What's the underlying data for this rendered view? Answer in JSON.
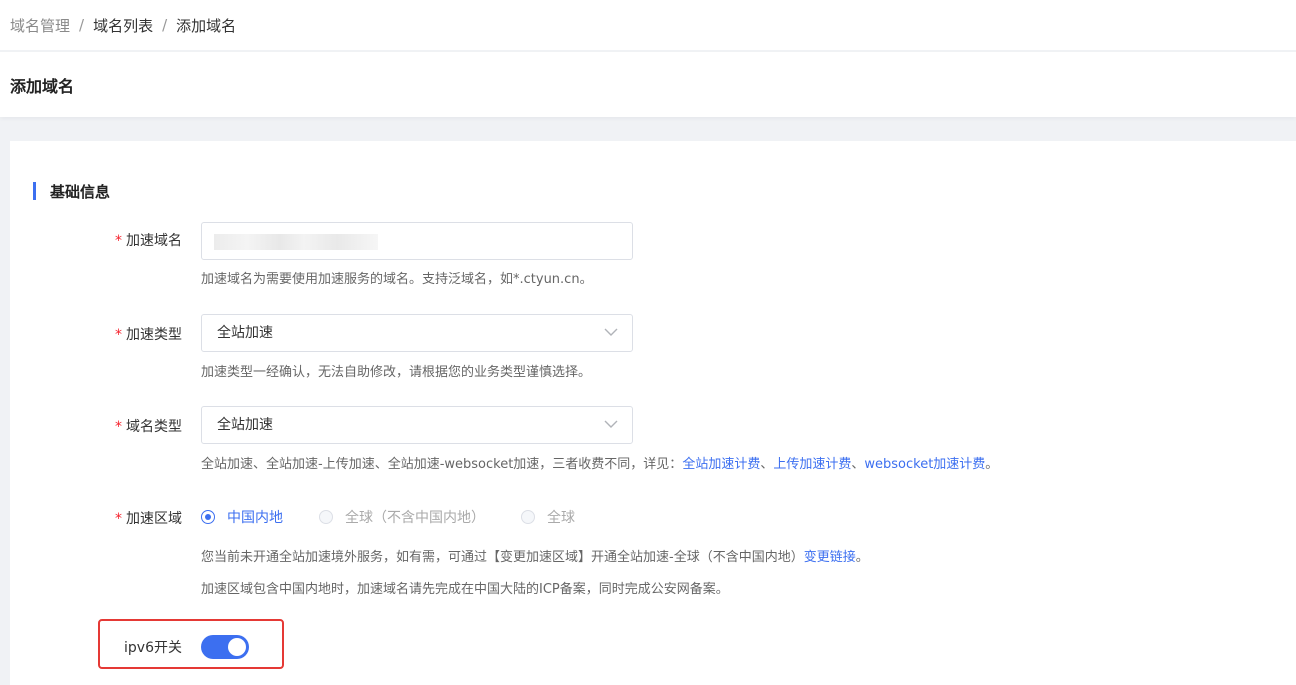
{
  "breadcrumb": {
    "items": [
      "域名管理",
      "域名列表",
      "添加域名"
    ],
    "separator": "/"
  },
  "page": {
    "title": "添加域名"
  },
  "section": {
    "title": "基础信息"
  },
  "form": {
    "required_mark": "*",
    "domain": {
      "label": "加速域名",
      "help": "加速域名为需要使用加速服务的域名。支持泛域名，如*.ctyun.cn。"
    },
    "accel_type": {
      "label": "加速类型",
      "value": "全站加速",
      "help": "加速类型一经确认，无法自助修改，请根据您的业务类型谨慎选择。"
    },
    "domain_type": {
      "label": "域名类型",
      "value": "全站加速",
      "help_prefix": "全站加速、全站加速-上传加速、全站加速-websocket加速，三者收费不同，详见：",
      "link1": "全站加速计费",
      "sep1": "、",
      "link2": "上传加速计费",
      "sep2": "、",
      "link3": "websocket加速计费",
      "help_suffix": "。"
    },
    "region": {
      "label": "加速区域",
      "options": [
        "中国内地",
        "全球（不含中国内地）",
        "全球"
      ],
      "help1_prefix": "您当前未开通全站加速境外服务，如有需，可通过【变更加速区域】开通全站加速-全球（不含中国内地）",
      "help1_link": "变更链接",
      "help1_suffix": "。",
      "help2": "加速区域包含中国内地时，加速域名请先完成在中国大陆的ICP备案，同时完成公安网备案。"
    },
    "ipv6": {
      "label": "ipv6开关",
      "enabled": true
    }
  },
  "colors": {
    "accent": "#3c6ff0",
    "required": "#f5222d",
    "highlight": "#e53935"
  }
}
